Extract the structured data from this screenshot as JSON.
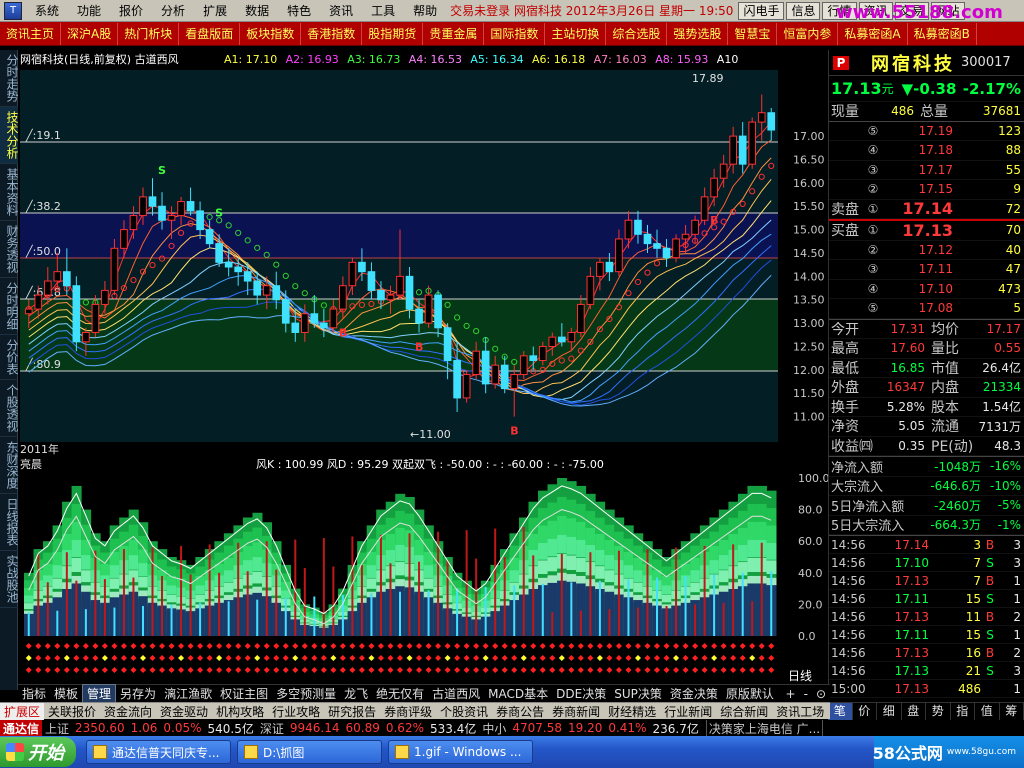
{
  "menubar": {
    "items": [
      "系统",
      "功能",
      "报价",
      "分析",
      "扩展",
      "数据",
      "特色",
      "资讯",
      "工具",
      "帮助"
    ],
    "alert": "交易未登录 网宿科技 2012年3月26日 星期一 19:50",
    "buttons": [
      "闪电手",
      "信息",
      "行情",
      "资讯",
      "交易",
      "网站"
    ],
    "watermark": "www.55188.com"
  },
  "toolbar": {
    "items": [
      "资讯主页",
      "深沪A股",
      "热门析块",
      "看盘版面",
      "板块指数",
      "香港指数",
      "股指期货",
      "贵重金属",
      "国际指数",
      "主站切换",
      "综合选股",
      "强势选股",
      "智慧宝",
      "恒富内参",
      "私募密函A",
      "私募密函B"
    ]
  },
  "lefttabs": [
    {
      "label": "分时走势",
      "active": false
    },
    {
      "label": "技术分析",
      "active": true
    },
    {
      "label": "基本资料",
      "active": false
    },
    {
      "label": "财务透视",
      "active": false
    },
    {
      "label": "分时明细",
      "active": false
    },
    {
      "label": "分价表",
      "active": false
    },
    {
      "label": "个股透视",
      "active": false
    },
    {
      "label": "东财深度",
      "active": false
    },
    {
      "label": "日线报表",
      "active": false
    },
    {
      "label": "实战股池",
      "active": false
    }
  ],
  "chart": {
    "header": "网宿科技(日线,前复权) 古道西风",
    "ma_labels": [
      {
        "text": "A1: 17.10",
        "color": "#ffff40"
      },
      {
        "text": "A2: 16.93",
        "color": "#ff40ff"
      },
      {
        "text": "A3: 16.73",
        "color": "#40ff40"
      },
      {
        "text": "A4: 16.53",
        "color": "#ff80ff"
      },
      {
        "text": "A5: 16.34",
        "color": "#40ffff"
      },
      {
        "text": "A6: 16.18",
        "color": "#ffff40"
      },
      {
        "text": "A7: 16.03",
        "color": "#ff80c0"
      },
      {
        "text": "A8: 15.93",
        "color": "#ff60ff"
      },
      {
        "text": "A10",
        "color": "#ffffff"
      }
    ],
    "fib_labels": [
      "╱:19.1",
      "╱:38.2",
      "╱:50.0",
      "╱:61.8",
      "╱:80.9"
    ],
    "y_ticks": [
      "17.00",
      "16.50",
      "16.00",
      "15.50",
      "15.00",
      "14.50",
      "14.00",
      "13.50",
      "13.00",
      "12.50",
      "12.00",
      "11.50",
      "11.00"
    ],
    "high_label": "17.89",
    "low_label": "←11.00",
    "year_label": "2011年",
    "sub_title": "亮晨",
    "sub_line": "风K : 100.99  风D : 95.29  双起双飞 : -50.00 : - : -60.00 : - : -75.00",
    "sub_ticks": [
      "100.0",
      "80.0",
      "60.0",
      "40.0",
      "20.0",
      "0.0"
    ],
    "period": "日线",
    "s_mark": "S",
    "b_mark": "B"
  },
  "chart_data": {
    "type": "candlestick",
    "title": "网宿科技(日线,前复权)",
    "ylim": [
      10.5,
      18.2
    ],
    "ohlc": [
      [
        13.2,
        13.5,
        12.9,
        13.3
      ],
      [
        13.3,
        13.8,
        13.1,
        13.6
      ],
      [
        13.6,
        14.2,
        13.4,
        13.9
      ],
      [
        13.9,
        14.5,
        13.7,
        14.1
      ],
      [
        14.1,
        14.6,
        13.6,
        13.8
      ],
      [
        13.8,
        14.0,
        12.4,
        12.6
      ],
      [
        12.6,
        12.9,
        12.3,
        12.8
      ],
      [
        12.8,
        13.6,
        12.7,
        13.4
      ],
      [
        13.4,
        13.9,
        13.2,
        13.7
      ],
      [
        13.7,
        14.8,
        13.6,
        14.6
      ],
      [
        14.6,
        15.2,
        14.4,
        15.0
      ],
      [
        15.0,
        15.5,
        14.8,
        15.3
      ],
      [
        15.3,
        15.9,
        15.1,
        15.7
      ],
      [
        15.7,
        16.1,
        15.3,
        15.5
      ],
      [
        15.5,
        15.8,
        15.0,
        15.2
      ],
      [
        15.2,
        15.5,
        14.8,
        15.3
      ],
      [
        15.3,
        15.7,
        15.1,
        15.6
      ],
      [
        15.6,
        15.9,
        15.3,
        15.4
      ],
      [
        15.4,
        15.6,
        14.8,
        15.0
      ],
      [
        15.0,
        15.2,
        14.6,
        14.7
      ],
      [
        14.7,
        14.9,
        14.2,
        14.3
      ],
      [
        14.3,
        14.6,
        14.0,
        14.2
      ],
      [
        14.2,
        14.4,
        13.8,
        14.1
      ],
      [
        14.1,
        14.3,
        13.6,
        13.9
      ],
      [
        13.9,
        14.1,
        13.4,
        13.6
      ],
      [
        13.6,
        14.0,
        13.3,
        13.8
      ],
      [
        13.8,
        14.1,
        13.3,
        13.5
      ],
      [
        13.5,
        13.7,
        12.8,
        13.0
      ],
      [
        13.0,
        13.3,
        12.6,
        12.8
      ],
      [
        12.8,
        13.4,
        12.6,
        13.2
      ],
      [
        13.2,
        13.6,
        12.9,
        13.0
      ],
      [
        13.0,
        13.3,
        12.7,
        12.9
      ],
      [
        12.9,
        13.5,
        12.8,
        13.3
      ],
      [
        13.3,
        14.0,
        13.1,
        13.8
      ],
      [
        13.8,
        14.4,
        13.6,
        14.3
      ],
      [
        14.3,
        14.6,
        13.9,
        14.1
      ],
      [
        14.1,
        14.3,
        13.5,
        13.7
      ],
      [
        13.7,
        13.9,
        13.3,
        13.5
      ],
      [
        13.5,
        13.8,
        13.2,
        13.6
      ],
      [
        13.6,
        15.0,
        13.5,
        14.0
      ],
      [
        14.0,
        14.2,
        13.1,
        13.3
      ],
      [
        13.3,
        13.5,
        12.8,
        13.0
      ],
      [
        13.0,
        13.8,
        12.9,
        13.6
      ],
      [
        13.6,
        13.7,
        12.7,
        12.9
      ],
      [
        12.9,
        13.0,
        11.8,
        12.2
      ],
      [
        12.2,
        12.6,
        11.1,
        11.4
      ],
      [
        11.4,
        12.0,
        11.3,
        11.9
      ],
      [
        11.9,
        12.6,
        11.8,
        12.4
      ],
      [
        12.4,
        12.7,
        11.5,
        11.7
      ],
      [
        11.7,
        12.3,
        11.6,
        12.1
      ],
      [
        12.1,
        12.3,
        11.5,
        11.6
      ],
      [
        11.6,
        12.1,
        11.0,
        11.9
      ],
      [
        11.9,
        12.4,
        11.8,
        12.3
      ],
      [
        12.3,
        12.5,
        12.0,
        12.2
      ],
      [
        12.2,
        12.6,
        12.1,
        12.5
      ],
      [
        12.5,
        12.8,
        12.3,
        12.7
      ],
      [
        12.7,
        13.0,
        12.5,
        12.6
      ],
      [
        12.6,
        12.9,
        12.4,
        12.8
      ],
      [
        12.8,
        13.6,
        12.7,
        13.4
      ],
      [
        13.4,
        14.2,
        13.3,
        14.0
      ],
      [
        14.0,
        14.4,
        13.7,
        14.3
      ],
      [
        14.3,
        14.5,
        13.9,
        14.1
      ],
      [
        14.1,
        15.0,
        14.0,
        14.8
      ],
      [
        14.8,
        15.4,
        14.6,
        15.2
      ],
      [
        15.2,
        15.4,
        14.7,
        14.9
      ],
      [
        14.9,
        15.1,
        14.5,
        14.7
      ],
      [
        14.7,
        15.0,
        14.4,
        14.6
      ],
      [
        14.6,
        14.8,
        14.2,
        14.4
      ],
      [
        14.4,
        14.9,
        14.3,
        14.8
      ],
      [
        14.8,
        15.1,
        14.5,
        14.9
      ],
      [
        14.9,
        15.3,
        14.7,
        15.2
      ],
      [
        15.2,
        15.9,
        15.1,
        15.7
      ],
      [
        15.7,
        16.3,
        15.5,
        16.1
      ],
      [
        16.1,
        16.6,
        15.9,
        16.4
      ],
      [
        16.4,
        17.2,
        16.2,
        17.0
      ],
      [
        17.0,
        17.3,
        16.2,
        16.4
      ],
      [
        16.4,
        17.4,
        16.3,
        17.3
      ],
      [
        17.3,
        17.89,
        16.9,
        17.5
      ],
      [
        17.5,
        17.6,
        16.9,
        17.13
      ]
    ],
    "volume_osc": [
      40,
      55,
      60,
      70,
      85,
      95,
      80,
      65,
      60,
      70,
      75,
      80,
      72,
      60,
      55,
      50,
      48,
      45,
      50,
      55,
      60,
      65,
      70,
      75,
      78,
      72,
      60,
      45,
      30,
      20,
      18,
      15,
      20,
      30,
      45,
      60,
      70,
      80,
      85,
      90,
      88,
      80,
      70,
      60,
      50,
      40,
      35,
      30,
      35,
      45,
      55,
      65,
      75,
      85,
      92,
      96,
      100,
      98,
      95,
      90,
      85,
      80,
      75,
      70,
      65,
      60,
      55,
      50,
      55,
      60,
      65,
      70,
      75,
      80,
      85,
      90,
      95,
      95,
      92
    ]
  },
  "quote": {
    "logo": "P",
    "name": "网宿科技",
    "code": "300017",
    "price": "17.13",
    "unit": "元",
    "change": "▼-0.38",
    "pct": "-2.17%",
    "now_label": "现量",
    "now": "486",
    "total_label": "总量",
    "total": "37681",
    "sell_label": "卖盘",
    "buy_label": "买盘",
    "asks": [
      {
        "n": "⑤",
        "p": "17.19",
        "v": "123"
      },
      {
        "n": "④",
        "p": "17.18",
        "v": "88"
      },
      {
        "n": "③",
        "p": "17.17",
        "v": "55"
      },
      {
        "n": "②",
        "p": "17.15",
        "v": "9"
      },
      {
        "n": "①",
        "p": "17.14",
        "v": "72"
      }
    ],
    "bids": [
      {
        "n": "①",
        "p": "17.13",
        "v": "70"
      },
      {
        "n": "②",
        "p": "17.12",
        "v": "40"
      },
      {
        "n": "③",
        "p": "17.11",
        "v": "47"
      },
      {
        "n": "④",
        "p": "17.10",
        "v": "473"
      },
      {
        "n": "⑤",
        "p": "17.08",
        "v": "5"
      }
    ],
    "stats": [
      {
        "l1": "今开",
        "v1": "17.31",
        "l2": "均价",
        "v2": "17.17",
        "c1": "red",
        "c2": "red"
      },
      {
        "l1": "最高",
        "v1": "17.60",
        "l2": "量比",
        "v2": "0.55",
        "c1": "red",
        "c2": "red"
      },
      {
        "l1": "最低",
        "v1": "16.85",
        "l2": "市值",
        "v2": "26.4亿",
        "c1": "green",
        "c2": "white"
      },
      {
        "l1": "外盘",
        "v1": "16347",
        "l2": "内盘",
        "v2": "21334",
        "c1": "red",
        "c2": "green"
      },
      {
        "l1": "换手",
        "v1": "5.28%",
        "l2": "股本",
        "v2": "1.54亿",
        "c1": "white",
        "c2": "white"
      },
      {
        "l1": "净资",
        "v1": "5.05",
        "l2": "流通",
        "v2": "7131万",
        "c1": "white",
        "c2": "white"
      },
      {
        "l1": "收益㈣",
        "v1": "0.35",
        "l2": "PE(动)",
        "v2": "48.3",
        "c1": "white",
        "c2": "white"
      }
    ],
    "flows": [
      {
        "l": "净流入额",
        "v": "-1048万",
        "p": "-16%"
      },
      {
        "l": "大宗流入",
        "v": "-646.6万",
        "p": "-10%"
      },
      {
        "l": "5日净流入额",
        "v": "-2460万",
        "p": "-5%"
      },
      {
        "l": "5日大宗流入",
        "v": "-664.3万",
        "p": "-1%"
      }
    ],
    "ticks": [
      {
        "t": "14:56",
        "p": "17.14",
        "v": "3",
        "d": "B",
        "n": "3"
      },
      {
        "t": "14:56",
        "p": "17.10",
        "v": "7",
        "d": "S",
        "n": "3"
      },
      {
        "t": "14:56",
        "p": "17.13",
        "v": "7",
        "d": "B",
        "n": "1"
      },
      {
        "t": "14:56",
        "p": "17.11",
        "v": "15",
        "d": "S",
        "n": "1"
      },
      {
        "t": "14:56",
        "p": "17.13",
        "v": "11",
        "d": "B",
        "n": "2"
      },
      {
        "t": "14:56",
        "p": "17.11",
        "v": "15",
        "d": "S",
        "n": "1"
      },
      {
        "t": "14:56",
        "p": "17.13",
        "v": "16",
        "d": "B",
        "n": "2"
      },
      {
        "t": "14:56",
        "p": "17.13",
        "v": "21",
        "d": "S",
        "n": "3"
      },
      {
        "t": "15:00",
        "p": "17.13",
        "v": "486",
        "d": "",
        "n": "1"
      }
    ]
  },
  "bottomtabs": [
    "指标",
    "模板",
    "管理",
    "另存为",
    "漓江渔歌",
    "权证主图",
    "多空预测量",
    "龙飞",
    "绝无仅有",
    "古道西风",
    "MACD基本",
    "DDE决策",
    "SUP决策",
    "资金决策",
    "原版默认"
  ],
  "bottomtabs_active": 2,
  "period_btns": [
    "+",
    "-",
    "⊙"
  ],
  "rightbtm": [
    "笔",
    "价",
    "细",
    "盘",
    "势",
    "指",
    "值",
    "筹"
  ],
  "linkbar": [
    "扩展区",
    "关联报价",
    "资金流向",
    "资金驱动",
    "机构攻略",
    "行业攻略",
    "研究报告",
    "券商评级",
    "个股资讯",
    "券商公告",
    "券商新闻",
    "财经精选",
    "行业新闻",
    "综合新闻",
    "资讯工场"
  ],
  "statusbar": {
    "brand": "通达信",
    "sh_label": "上证",
    "sh": "2350.60",
    "sh_chg": "1.06",
    "sh_pct": "0.05%",
    "sh_amt": "540.5亿",
    "sz_label": "深证",
    "sz": "9946.14",
    "sz_chg": "60.89",
    "sz_pct": "0.62%",
    "sz_amt": "533.4亿",
    "cy_label": "中小",
    "cy": "4707.58",
    "cy_chg": "19.20",
    "cy_pct": "0.41%",
    "cy_amt": "236.7亿",
    "tail": "决策家上海电信 广..."
  },
  "taskbar": {
    "start": "开始",
    "windows": [
      "通达信普天同庆专...",
      "D:\\抓图",
      "1.gif - Windows ..."
    ],
    "tray": "58公式网",
    "tray2": "www.58gu.com"
  }
}
